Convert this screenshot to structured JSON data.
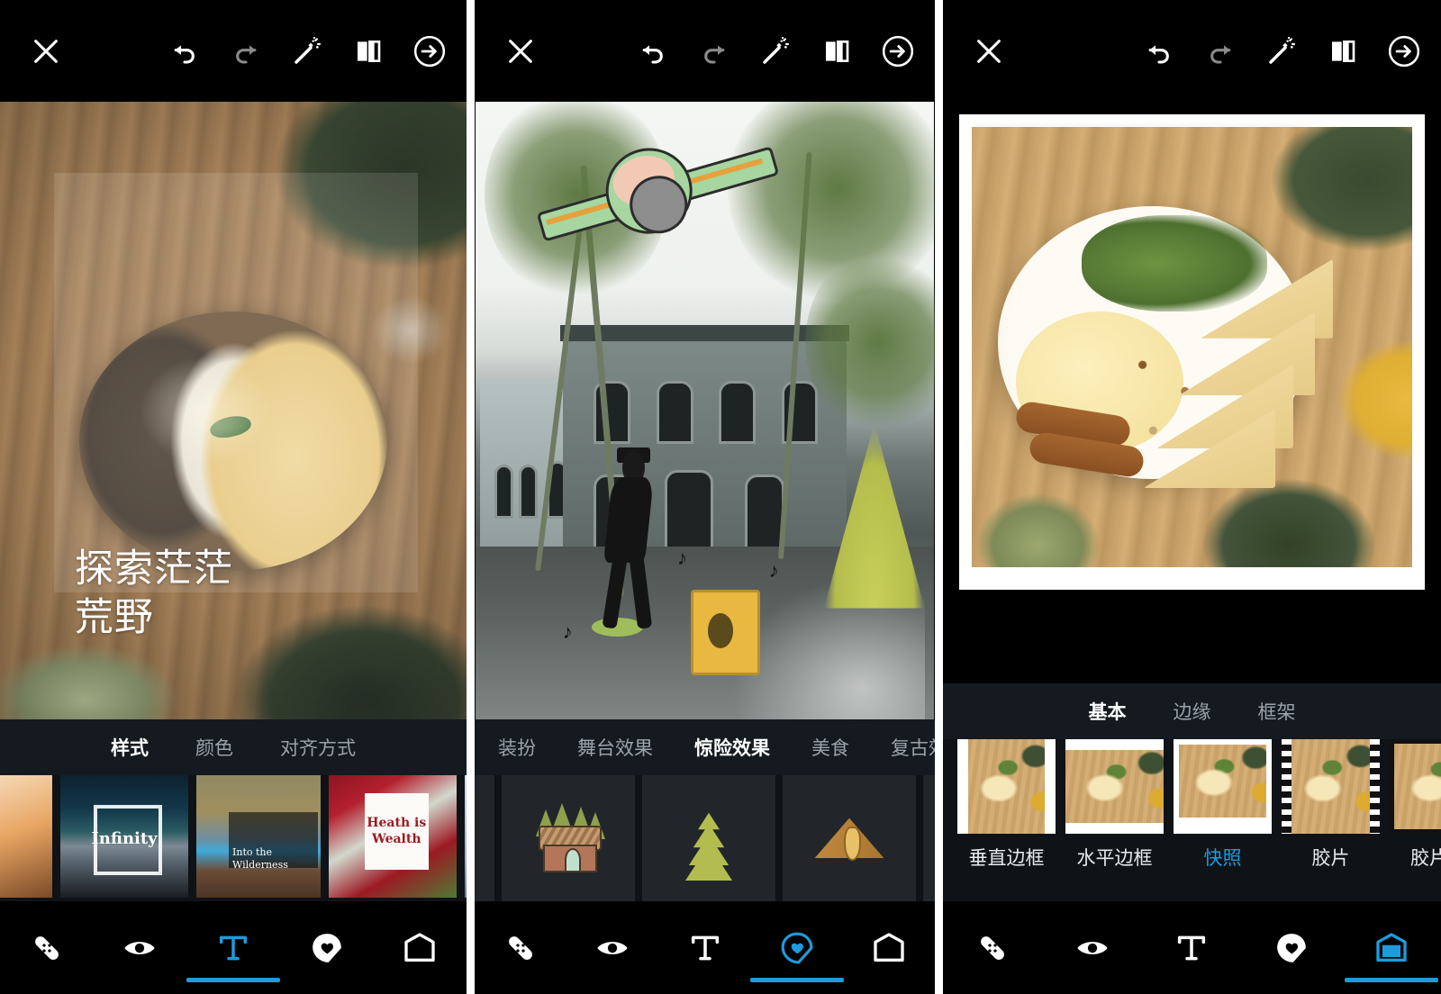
{
  "app": {
    "accent_color": "#1e9bdc",
    "tab_bar_bg": "#141a20",
    "toolbar_bg": "#000000"
  },
  "toolbar": {
    "close_label": "close-icon",
    "undo_label": "undo-icon",
    "redo_label": "redo-icon",
    "magic_label": "magic-wand-icon",
    "compare_label": "compare-icon",
    "next_label": "next-arrow-icon"
  },
  "bottom_nav": {
    "items": [
      {
        "name": "retouch",
        "icon": "bandage-icon"
      },
      {
        "name": "effects",
        "icon": "eye-icon"
      },
      {
        "name": "text",
        "icon": "text-icon"
      },
      {
        "name": "sticker",
        "icon": "sticker-icon"
      },
      {
        "name": "frame",
        "icon": "frame-icon"
      }
    ]
  },
  "panel1": {
    "tabs": [
      {
        "label": "样式",
        "active": true
      },
      {
        "label": "颜色",
        "active": false
      },
      {
        "label": "对齐方式",
        "active": false
      }
    ],
    "overlay_text_line1": "探索茫茫",
    "overlay_text_line2": "荒野",
    "overlay_text_color": "#ffffff",
    "active_nav": "text",
    "thumbnails": [
      {
        "label": "",
        "name": "style-thumb-sunset"
      },
      {
        "label": "Infinity",
        "name": "style-thumb-infinity"
      },
      {
        "label": "Into the\nWilderness",
        "label_line1": "Into the",
        "label_line2": "Wilderness",
        "name": "style-thumb-wilderness"
      },
      {
        "label_line1": "Heath is",
        "label_line2": "Wealth",
        "name": "style-thumb-heath"
      },
      {
        "label": "",
        "name": "style-thumb-partial"
      }
    ]
  },
  "panel2": {
    "tabs": [
      {
        "label": "装扮",
        "active": false
      },
      {
        "label": "舞台效果",
        "active": false
      },
      {
        "label": "惊险效果",
        "active": true
      },
      {
        "label": "美食",
        "active": false
      },
      {
        "label": "复古效果",
        "active": false
      }
    ],
    "active_nav": "sticker",
    "stickers": [
      {
        "name": "sticker-cabin"
      },
      {
        "name": "sticker-pine-tree"
      },
      {
        "name": "sticker-tent-guitar"
      }
    ],
    "canvas_stickers": [
      {
        "name": "airplane-sticker"
      },
      {
        "name": "dancer-sticker"
      },
      {
        "name": "pine-tree-sticker"
      },
      {
        "name": "gramophone-sticker"
      },
      {
        "name": "music-note-sticker"
      }
    ]
  },
  "panel3": {
    "tabs": [
      {
        "label": "基本",
        "active": true
      },
      {
        "label": "边缘",
        "active": false
      },
      {
        "label": "框架",
        "active": false
      }
    ],
    "active_nav": "frame",
    "frames": [
      {
        "label": "垂直边框",
        "active": false
      },
      {
        "label": "水平边框",
        "active": false
      },
      {
        "label": "快照",
        "active": true
      },
      {
        "label": "胶片",
        "active": false
      },
      {
        "label": "胶片彩",
        "active": false
      }
    ]
  }
}
